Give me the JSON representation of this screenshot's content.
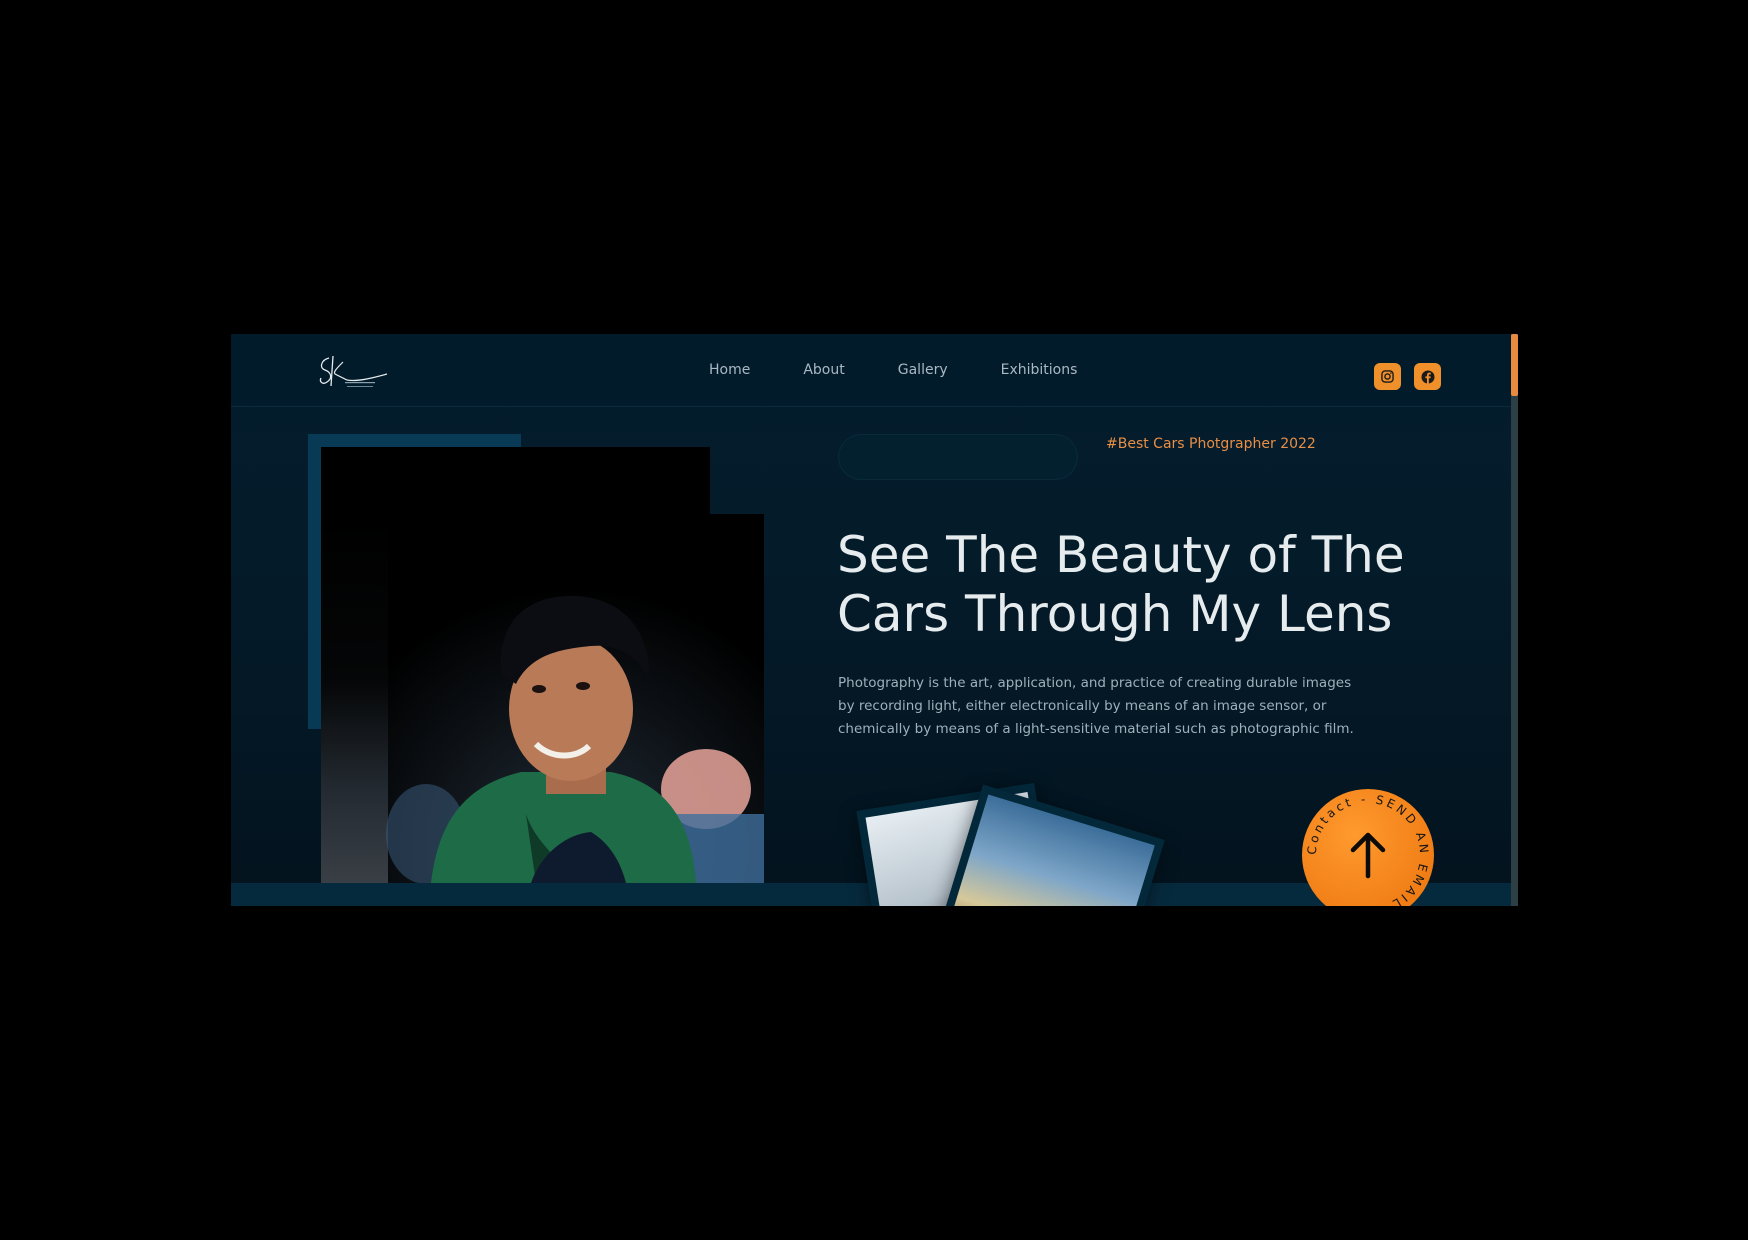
{
  "header": {
    "logo_alt": "signature logo",
    "nav": {
      "home": "Home",
      "about": "About",
      "gallery": "Gallery",
      "exhibitions": "Exhibitions"
    },
    "social": {
      "instagram_icon": "instagram-icon",
      "facebook_icon": "facebook-icon"
    }
  },
  "hero": {
    "tag": "#Best Cars Photgrapher 2022",
    "headline_line1": "See The Beauty of The",
    "headline_line2": "Cars Through My Lens",
    "description": "Photography is the art, application, and practice of creating durable images by recording light, either electronically by means of an image sensor, or chemically by means of a light-sensitive material such as photographic film.",
    "contact_badge_text": "Contact - SEND AN EMAIL - ",
    "contact_icon": "arrow-up-icon"
  },
  "colors": {
    "accent": "#f0902a",
    "background": "#031c2c",
    "text": "#e6ebee"
  }
}
